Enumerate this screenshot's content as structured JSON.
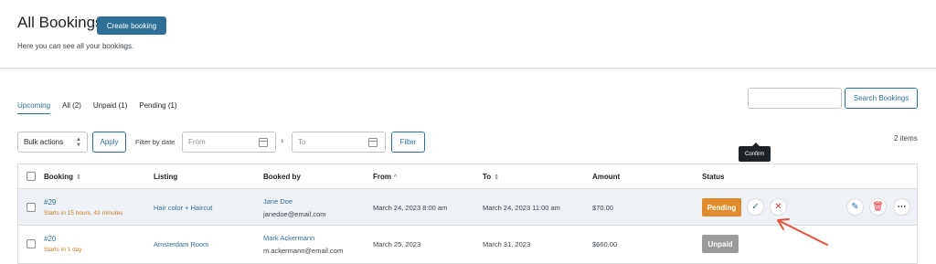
{
  "header": {
    "title": "All Bookings",
    "create_label": "Create booking",
    "subtitle": "Here you can see all your bookings."
  },
  "tabs": [
    {
      "label": "Upcoming",
      "active": true
    },
    {
      "label": "All (2)",
      "active": false
    },
    {
      "label": "Unpaid (1)",
      "active": false
    },
    {
      "label": "Pending (1)",
      "active": false
    }
  ],
  "search": {
    "value": "",
    "button_label": "Search Bookings"
  },
  "toolbar": {
    "bulk_label": "Bulk actions",
    "apply_label": "Apply",
    "filter_by_date_label": "Filter by date",
    "from_placeholder": "From",
    "to_placeholder": "To",
    "filter_label": "Filter",
    "items_count": "2 items"
  },
  "table": {
    "columns": [
      "Booking",
      "Listing",
      "Booked by",
      "From",
      "To",
      "Amount",
      "Status"
    ],
    "rows": [
      {
        "id": "#29",
        "starts": "Starts in 15 hours, 43 minutes",
        "listing": "Hair color + Haircut",
        "name": "Jane Doe",
        "email": "janedoe@email.com",
        "from": "March 24, 2023 8:00 am",
        "to": "March 24, 2023 11:00 am",
        "amount": "$70.00",
        "status": "Pending"
      },
      {
        "id": "#20",
        "starts": "Starts in 1 day",
        "listing": "Amsterdam Room",
        "name": "Mark Ackermann",
        "email": "m.ackermann@email.com",
        "from": "March 25, 2023",
        "to": "March 31, 2023",
        "amount": "$660.00",
        "status": "Unpaid"
      }
    ]
  },
  "tooltip": "Confirm",
  "colors": {
    "accent": "#2f6f95",
    "pending": "#e08c2e",
    "unpaid": "#9b9b9b",
    "annotation": "#e5533d"
  }
}
